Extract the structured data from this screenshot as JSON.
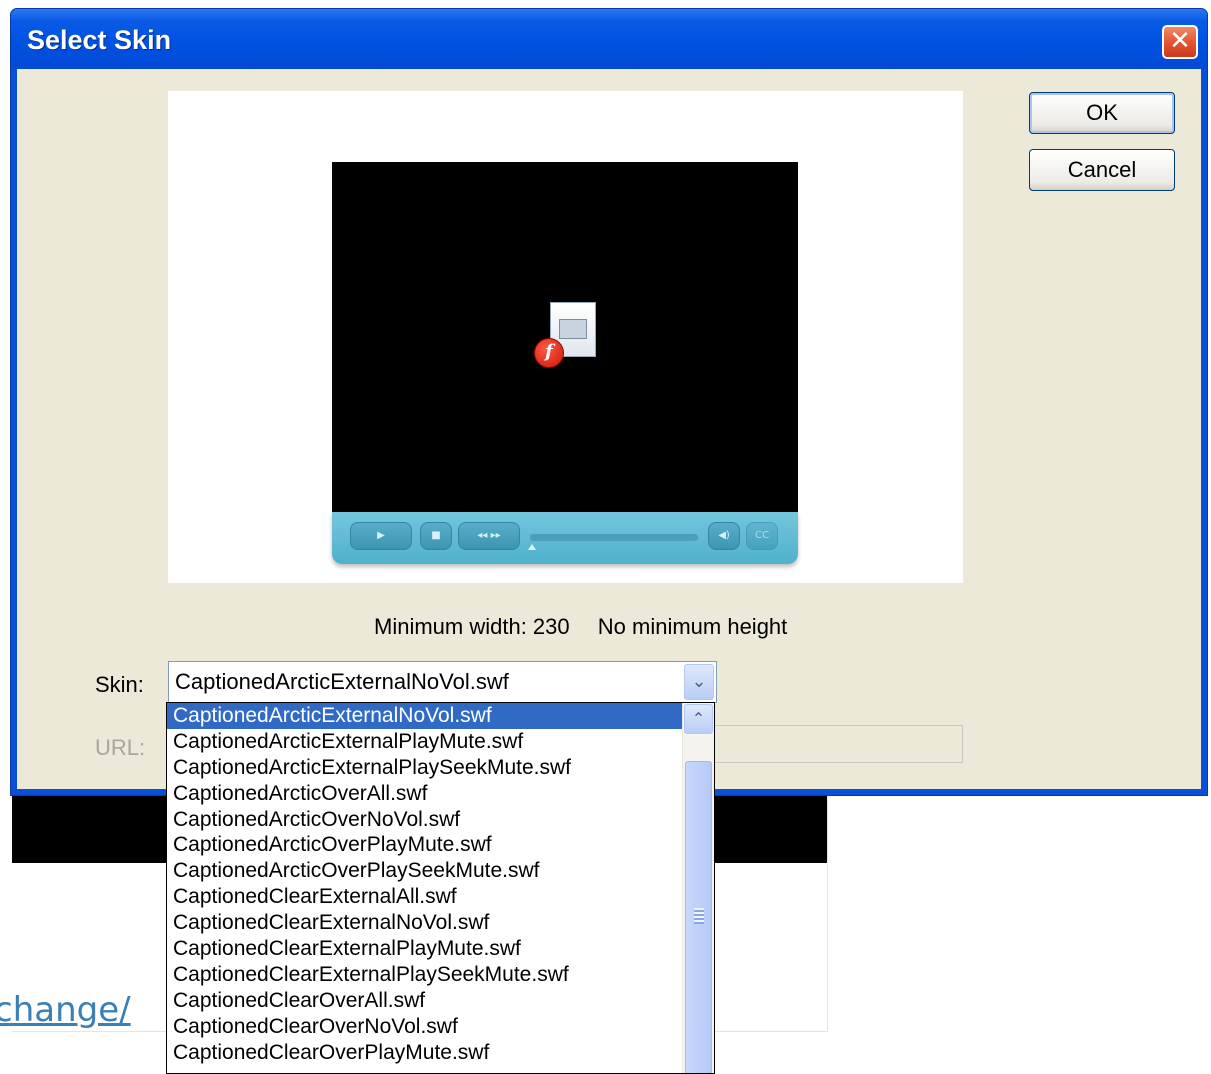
{
  "background": {
    "link_text": "change/"
  },
  "dialog": {
    "title": "Select Skin",
    "close_glyph": "✕",
    "preview": {
      "size_info": {
        "min_width": "Minimum width: 230",
        "min_height": "No minimum height"
      }
    },
    "skin_label": "Skin:",
    "skin_value": "CaptionedArcticExternalNoVol.swf",
    "url_label": "URL:",
    "url_value": "",
    "ok_label": "OK",
    "cancel_label": "Cancel",
    "dropdown": {
      "selected_index": 0,
      "items": [
        "CaptionedArcticExternalNoVol.swf",
        "CaptionedArcticExternalPlayMute.swf",
        "CaptionedArcticExternalPlaySeekMute.swf",
        "CaptionedArcticOverAll.swf",
        "CaptionedArcticOverNoVol.swf",
        "CaptionedArcticOverPlayMute.swf",
        "CaptionedArcticOverPlaySeekMute.swf",
        "CaptionedClearExternalAll.swf",
        "CaptionedClearExternalNoVol.swf",
        "CaptionedClearExternalPlayMute.swf",
        "CaptionedClearExternalPlaySeekMute.swf",
        "CaptionedClearOverAll.swf",
        "CaptionedClearOverNoVol.swf",
        "CaptionedClearOverPlayMute.swf"
      ]
    }
  },
  "colors": {
    "title_bar": "#0052e2",
    "dialog_face": "#ece9d8",
    "selection": "#316ac5",
    "skin_control_bar": "#5bb8d1"
  }
}
